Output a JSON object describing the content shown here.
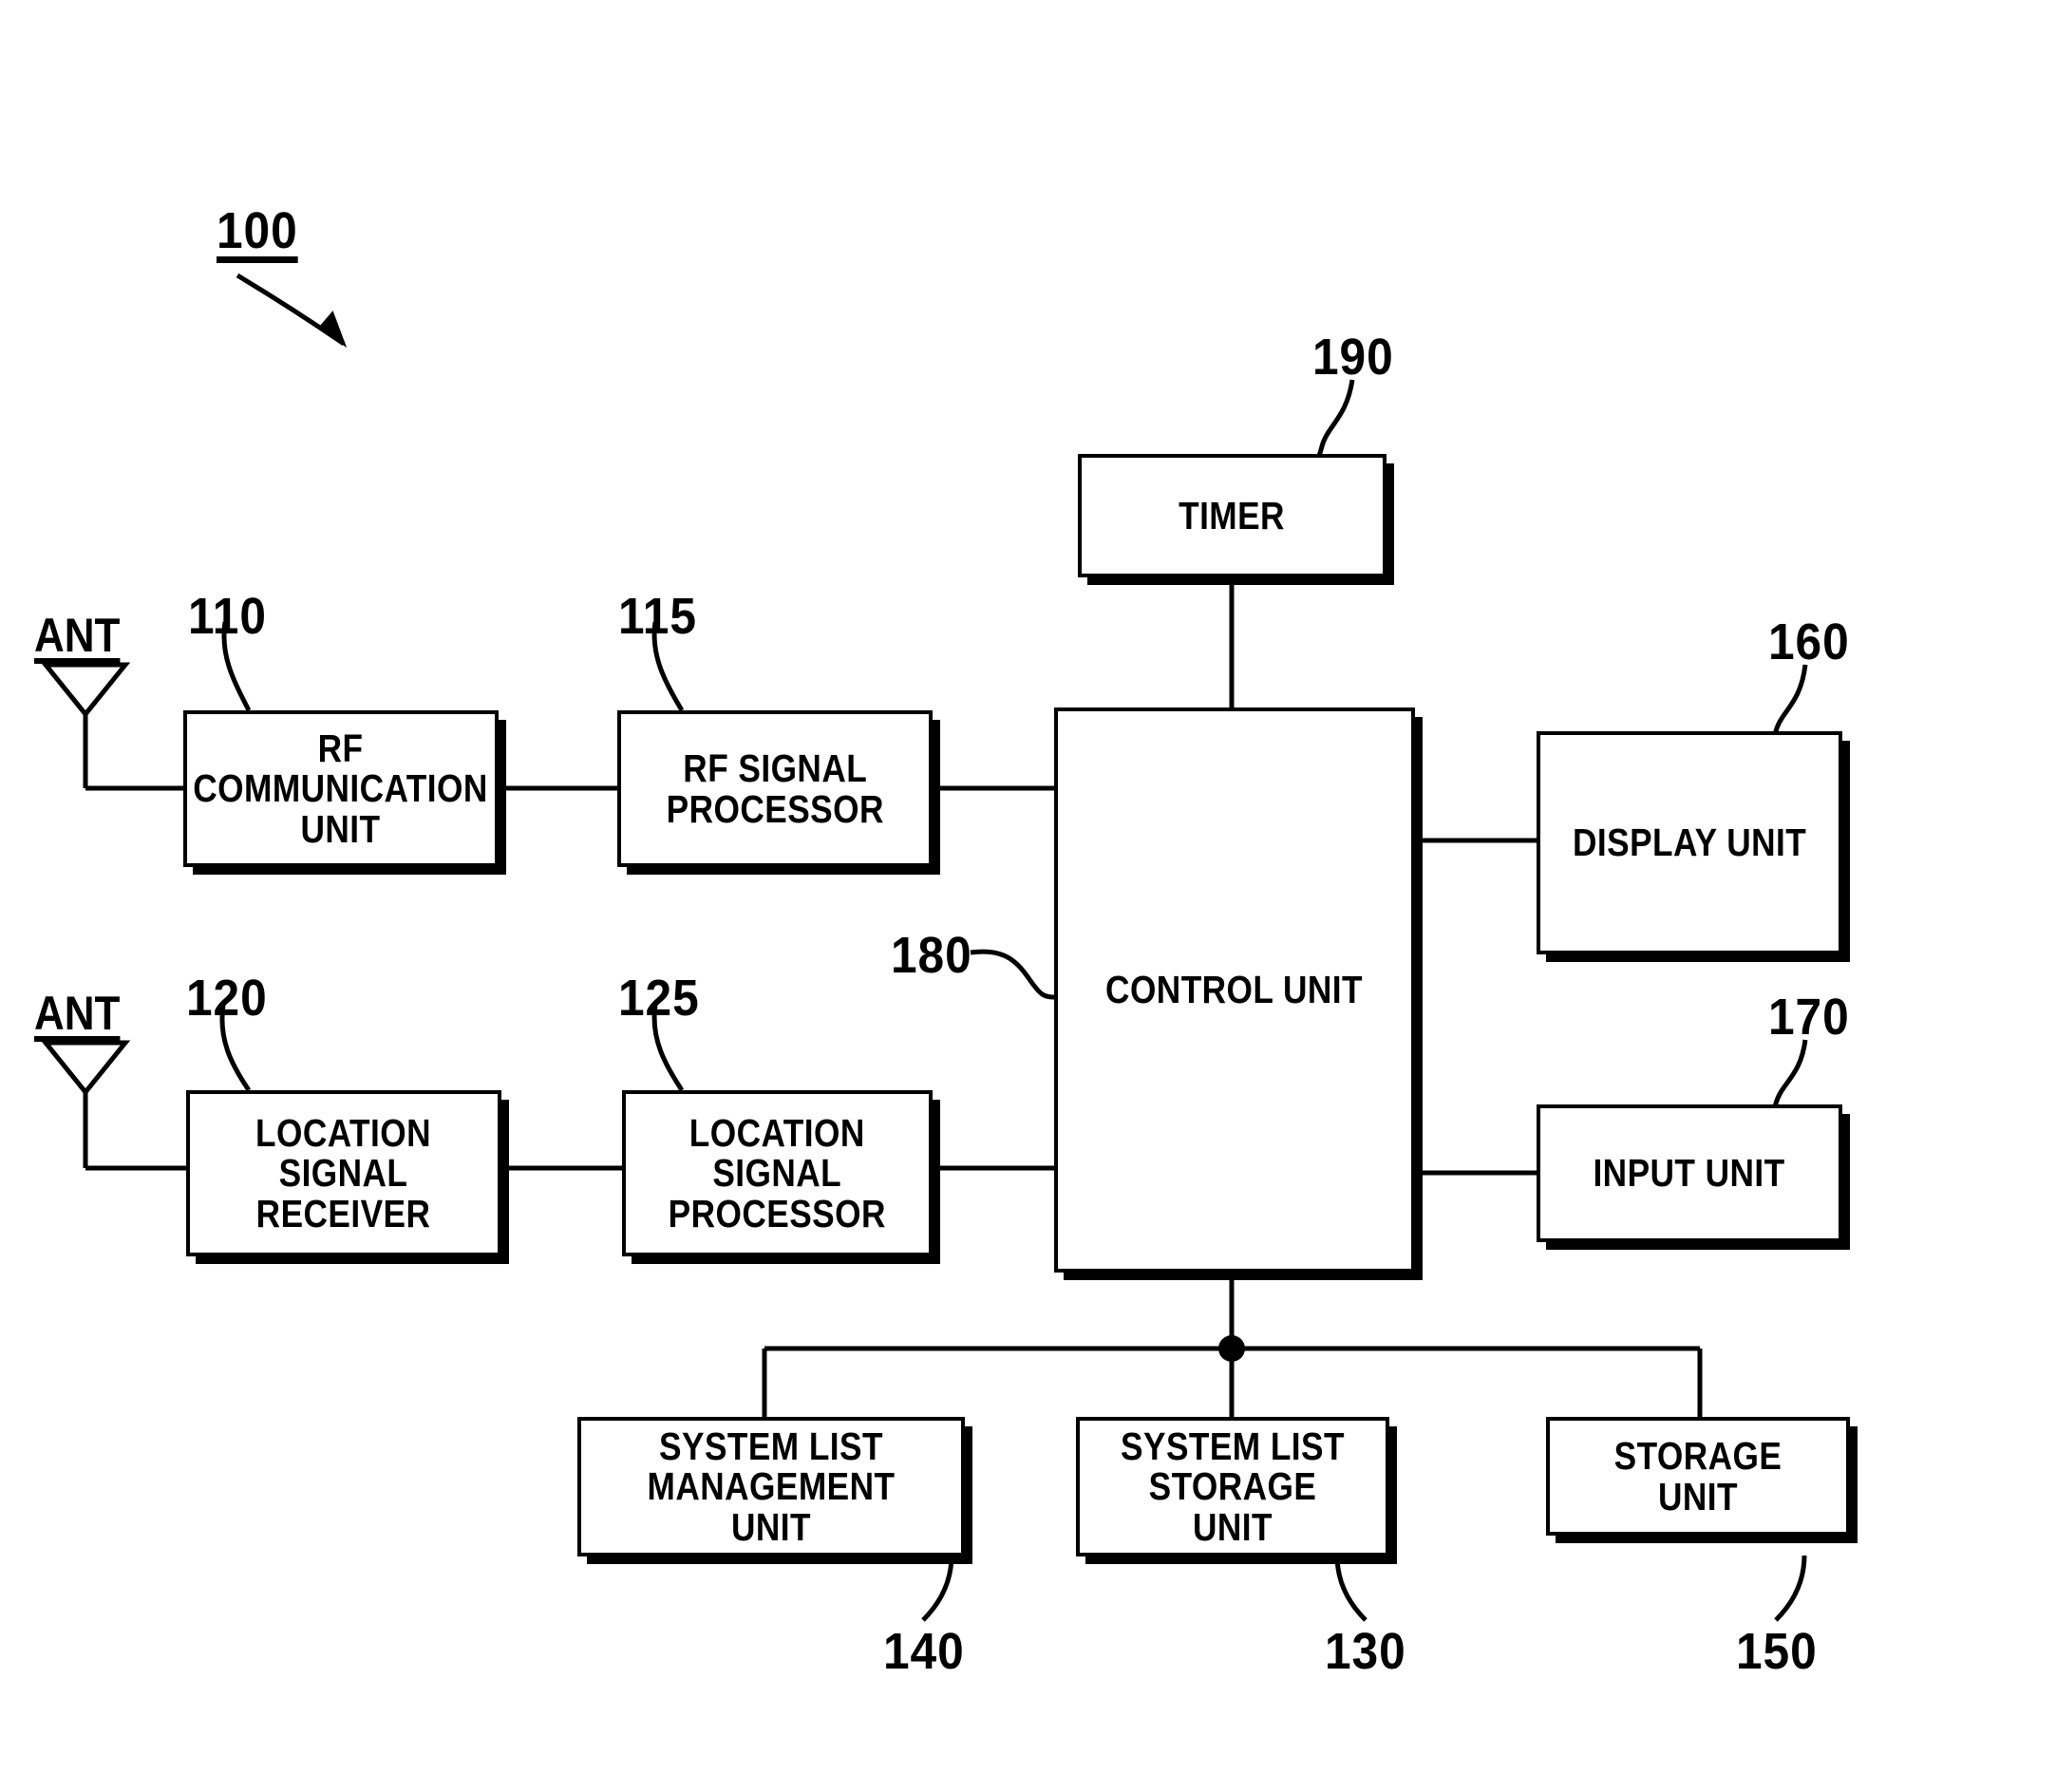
{
  "figure": {
    "id_label": "100",
    "antenna_label_top": "ANT",
    "antenna_label_bottom": "ANT"
  },
  "blocks": [
    {
      "key": "rf_comm",
      "label": "RF\nCOMMUNICATION\nUNIT",
      "ref": "110"
    },
    {
      "key": "rf_proc",
      "label": "RF SIGNAL\nPROCESSOR",
      "ref": "115"
    },
    {
      "key": "loc_recv",
      "label": "LOCATION\nSIGNAL\nRECEIVER",
      "ref": "120"
    },
    {
      "key": "loc_proc",
      "label": "LOCATION\nSIGNAL\nPROCESSOR",
      "ref": "125"
    },
    {
      "key": "timer",
      "label": "TIMER",
      "ref": "190"
    },
    {
      "key": "control",
      "label": "CONTROL UNIT",
      "ref": "180"
    },
    {
      "key": "display",
      "label": "DISPLAY UNIT",
      "ref": "160"
    },
    {
      "key": "input",
      "label": "INPUT UNIT",
      "ref": "170"
    },
    {
      "key": "list_mgmt",
      "label": "SYSTEM LIST\nMANAGEMENT UNIT",
      "ref": "140"
    },
    {
      "key": "list_store",
      "label": "SYSTEM LIST\nSTORAGE UNIT",
      "ref": "130"
    },
    {
      "key": "storage",
      "label": "STORAGE UNIT",
      "ref": "150"
    }
  ],
  "colors": {
    "line": "#000000",
    "background": "#ffffff"
  }
}
